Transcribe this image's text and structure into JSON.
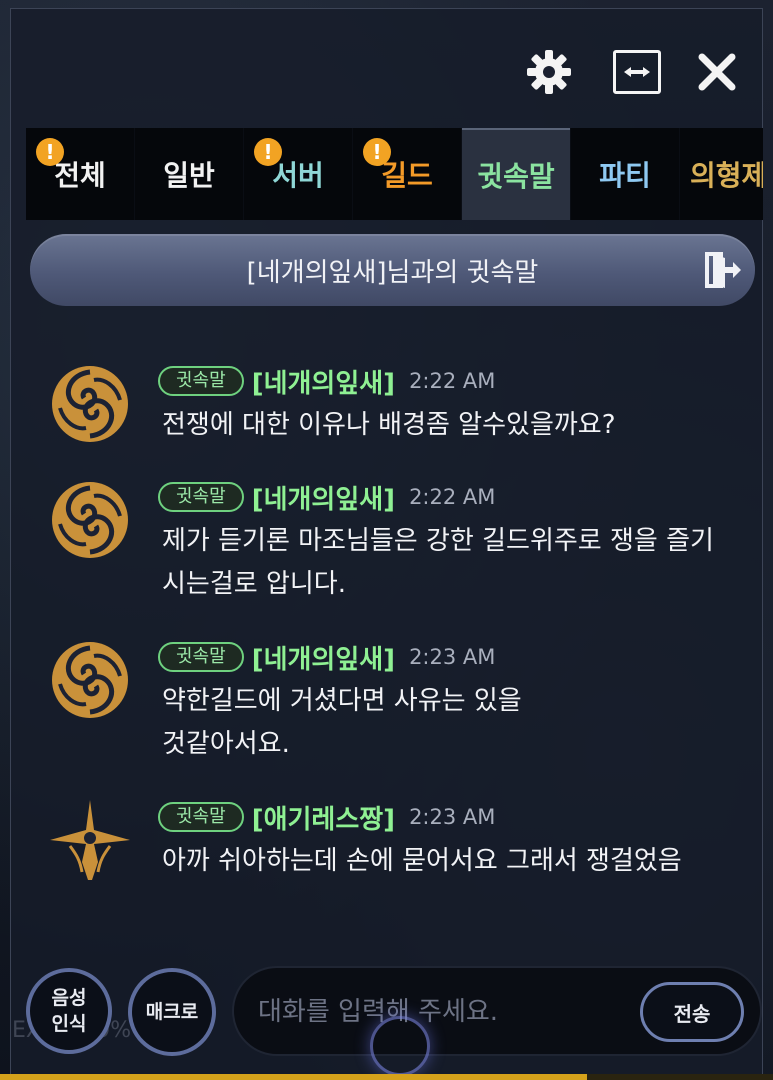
{
  "window": {
    "icons": {
      "settings": "gear-icon",
      "resize": "expand-horizontal-icon",
      "close": "close-icon"
    }
  },
  "tabs": [
    {
      "label": "전체",
      "badge": "!",
      "color": "#f2f2f2"
    },
    {
      "label": "일반",
      "badge": "",
      "color": "#f2f2f2"
    },
    {
      "label": "서버",
      "badge": "!",
      "color": "#8fd7d6"
    },
    {
      "label": "길드",
      "badge": "!",
      "color": "#f39a28"
    },
    {
      "label": "귓속말",
      "badge": "",
      "color": "#8be3a0",
      "active": true
    },
    {
      "label": "파티",
      "badge": "",
      "color": "#8fc9f2"
    },
    {
      "label": "의형제",
      "badge": "",
      "color": "#d9b058"
    }
  ],
  "whisper_bar": {
    "title": "[네개의잎새]님과의 귓속말",
    "exit_icon": "exit-door-icon"
  },
  "messages": [
    {
      "tag": "귓속말",
      "sender": "[네개의잎새]",
      "time": "2:22 AM",
      "text": "전쟁에 대한 이유나 배경좀 알수있을까요?",
      "avatar": "swirl-emblem-icon"
    },
    {
      "tag": "귓속말",
      "sender": "[네개의잎새]",
      "time": "2:22 AM",
      "text": "제가 듣기론 마조님들은 강한 길드위주로 쟁을 즐기시는걸로 압니다.",
      "avatar": "swirl-emblem-icon"
    },
    {
      "tag": "귓속말",
      "sender": "[네개의잎새]",
      "time": "2:23 AM",
      "text": "약한길드에 거셨다면 사유는 있을것같아서요.",
      "avatar": "swirl-emblem-icon"
    },
    {
      "tag": "귓속말",
      "sender": "[애기레스짱]",
      "time": "2:23 AM",
      "text": "아까 쉬아하는데 손에 묻어서요 그래서 쟁걸었음",
      "avatar": "cross-emblem-icon"
    }
  ],
  "bottom": {
    "voice_label": "음성\n인식",
    "macro_label": "매크로",
    "input_placeholder": "대화를 입력해 주세요.",
    "send_label": "전송",
    "exp_text": "EXP 75.9%",
    "exp_percent": 75.9
  },
  "colors": {
    "whisper_green": "#8ff093",
    "badge_orange": "#f2a323",
    "emblem_gold": "#c9913a"
  }
}
